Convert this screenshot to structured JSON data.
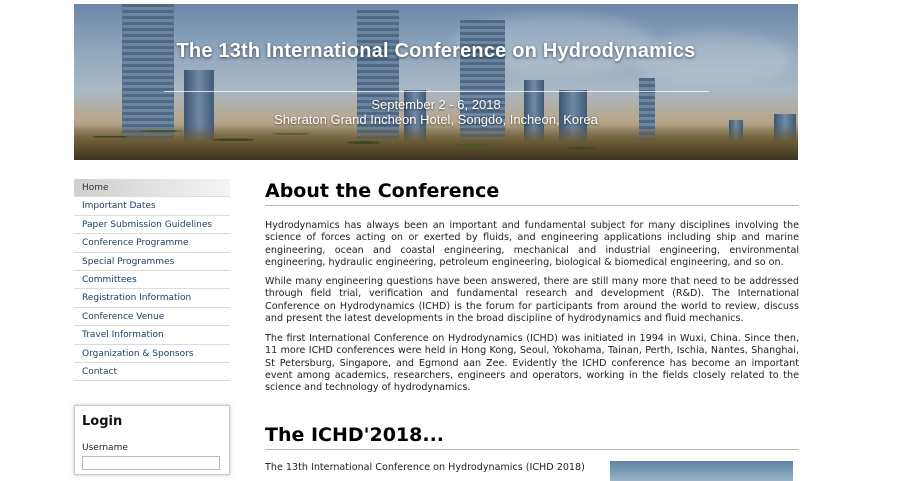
{
  "banner": {
    "title": "The 13th International Conference on Hydrodynamics",
    "date": "September 2 - 6, 2018",
    "venue": "Sheraton Grand Incheon Hotel, Songdo, Incheon, Korea"
  },
  "nav": {
    "items": [
      {
        "label": "Home"
      },
      {
        "label": "Important Dates"
      },
      {
        "label": "Paper Submission Guidelines"
      },
      {
        "label": "Conference Programme"
      },
      {
        "label": "Special Programmes"
      },
      {
        "label": "Committees"
      },
      {
        "label": "Registration Information"
      },
      {
        "label": "Conference Venue"
      },
      {
        "label": "Travel Information"
      },
      {
        "label": "Organization & Sponsors"
      },
      {
        "label": "Contact"
      }
    ],
    "active_index": 0
  },
  "login": {
    "title": "Login",
    "username_label": "Username",
    "username_value": ""
  },
  "main": {
    "heading_about": "About the Conference",
    "para1": "Hydrodynamics has always been an important and fundamental subject for many disciplines involving the science of forces acting on or exerted by fluids, and engineering applications including ship and marine engineering, ocean and coastal engineering, mechanical and industrial engineering, environmental engineering, hydraulic engineering, petroleum engineering, biological & biomedical engineering, and so on.",
    "para2": "While many engineering questions have been answered, there are still many more that need to be addressed through field trial, verification and fundamental research and development (R&D). The International Conference on Hydrodynamics (ICHD) is the forum for participants from around the world to review, discuss and present the latest developments in the broad discipline of hydrodynamics and fluid mechanics.",
    "para3": "The first International Conference on Hydrodynamics (ICHD) was initiated in 1994 in Wuxi, China. Since then, 11 more ICHD conferences were held in Hong Kong, Seoul, Yokohama, Tainan, Perth, Ischia, Nantes, Shanghai, St Petersburg, Singapore, and Egmond aan Zee. Evidently the ICHD conference has become an important event among academics, researchers, engineers and operators, working in the fields closely related to the science and technology of hydrodynamics.",
    "heading_ichd": "The ICHD'2018...",
    "para4": "The 13th International Conference on Hydrodynamics (ICHD 2018)"
  },
  "colors": {
    "nav_link": "#1a3f66",
    "heading": "#000000",
    "rule": "#b9b9b9"
  }
}
